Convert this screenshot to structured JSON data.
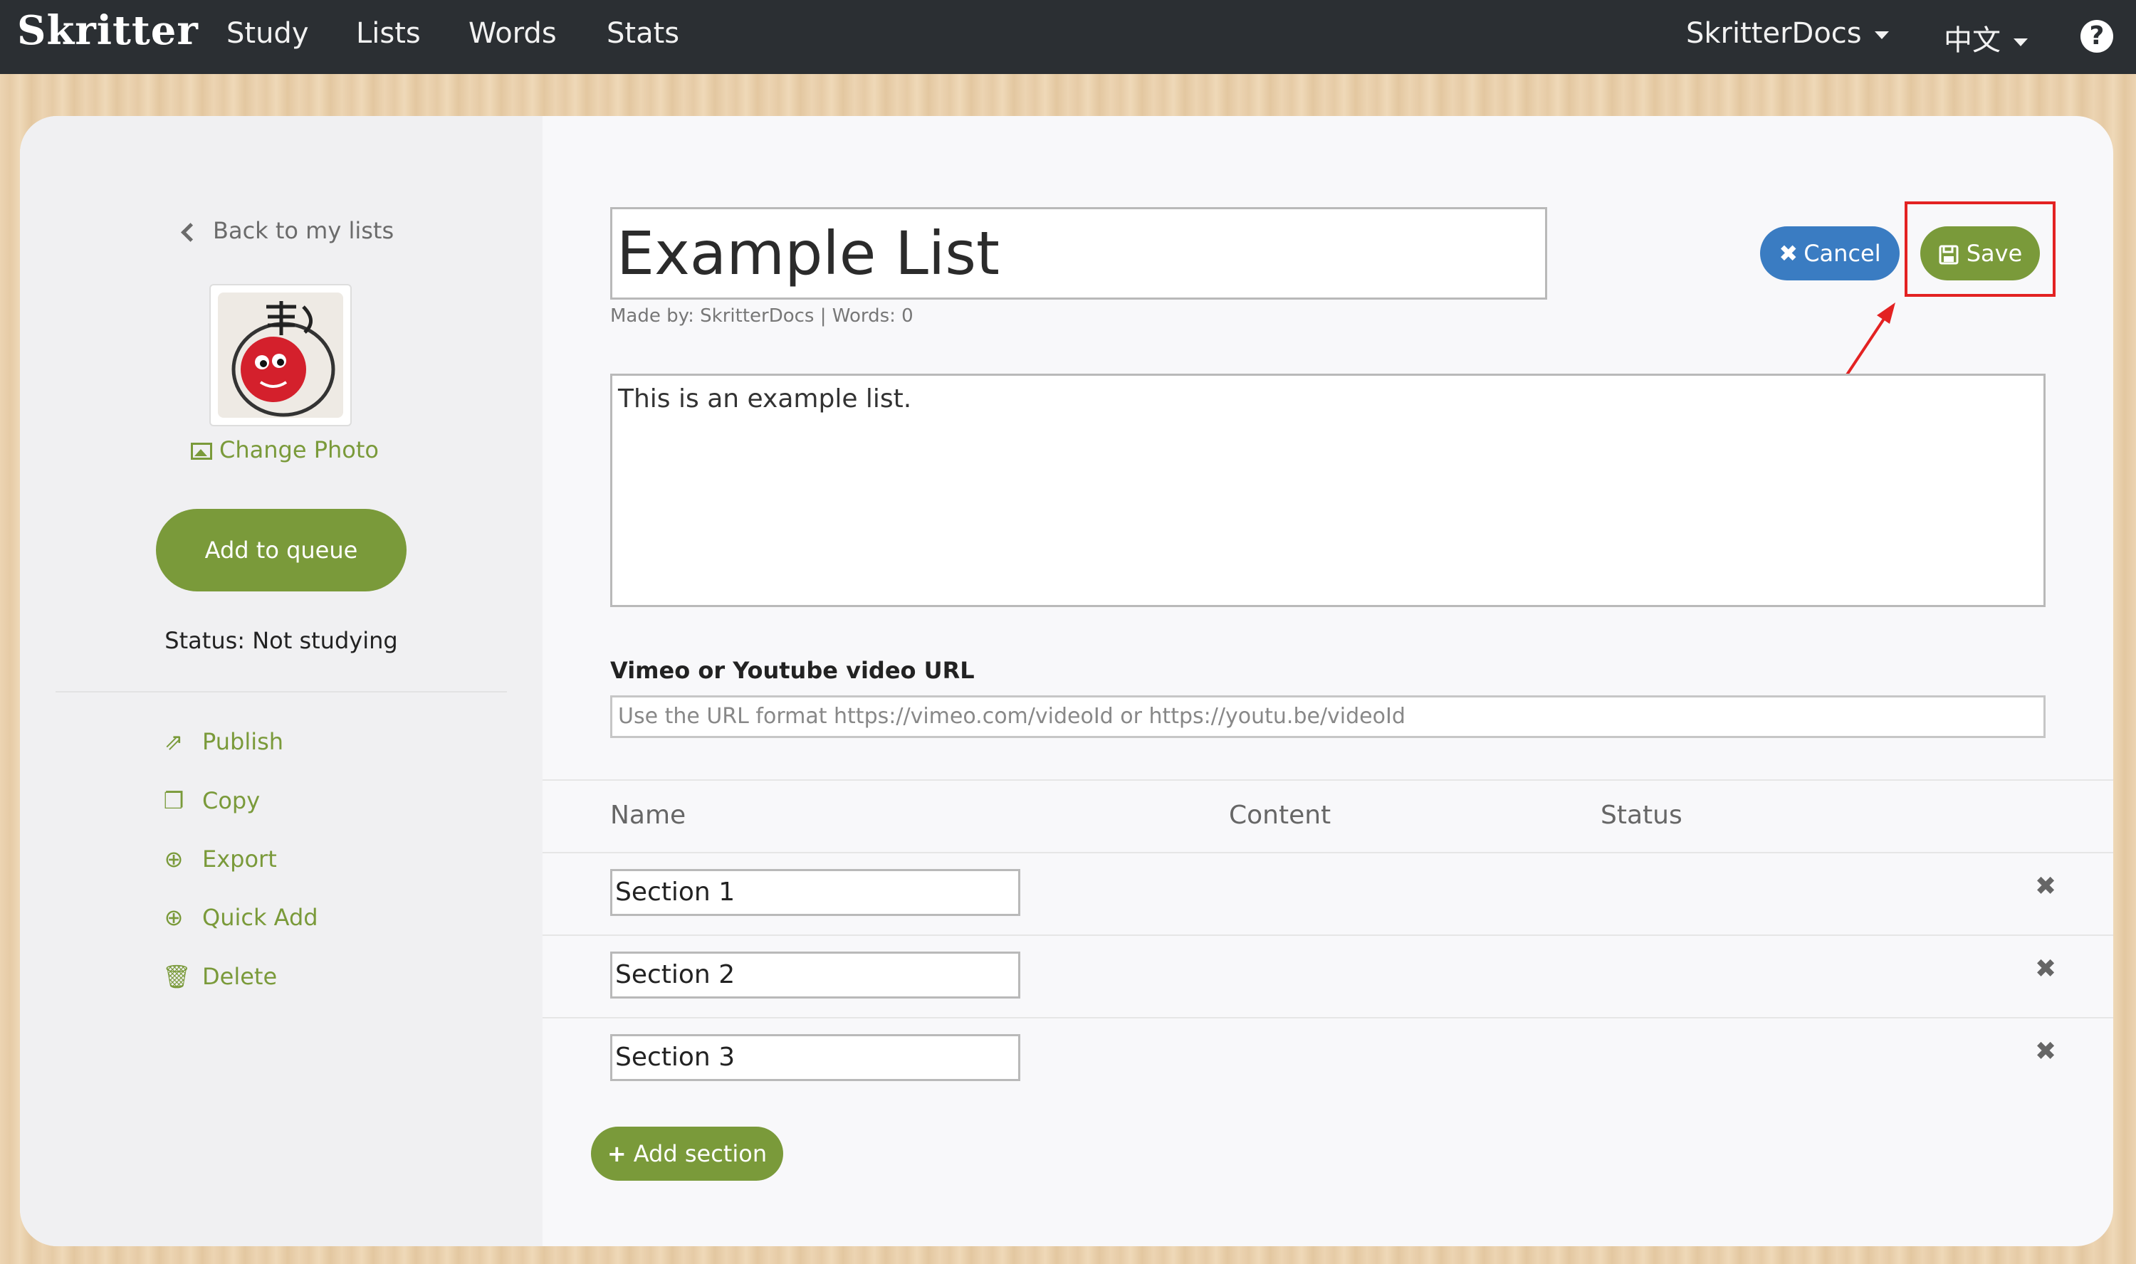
{
  "navbar": {
    "brand": "Skritter",
    "items": [
      "Study",
      "Lists",
      "Words",
      "Stats"
    ],
    "user_menu": "SkritterDocs",
    "language_menu": "中文",
    "help_label": "?"
  },
  "sidebar": {
    "back_label": "Back to my lists",
    "change_photo_label": "Change Photo",
    "queue_button": "Add to queue",
    "status_text": "Status: Not studying",
    "actions": [
      {
        "label": "Publish",
        "icon": "share-icon"
      },
      {
        "label": "Copy",
        "icon": "copy-icon"
      },
      {
        "label": "Export",
        "icon": "download-icon"
      },
      {
        "label": "Quick Add",
        "icon": "plus-circle-icon"
      },
      {
        "label": "Delete",
        "icon": "trash-icon"
      }
    ]
  },
  "editor": {
    "title_value": "Example List",
    "made_by": "Made by: SkritterDocs | Words: 0",
    "cancel_label": "Cancel",
    "save_label": "Save",
    "description_value": "This is an example list.",
    "video_label": "Vimeo or Youtube video URL",
    "video_placeholder": "Use the URL format https://vimeo.com/videoId or https://youtu.be/videoId"
  },
  "table": {
    "headers": [
      "Name",
      "Content",
      "Status"
    ],
    "rows": [
      {
        "name": "Section 1"
      },
      {
        "name": "Section 2"
      },
      {
        "name": "Section 3"
      }
    ],
    "remove_glyph": "✖",
    "add_section_label": "Add section"
  },
  "colors": {
    "navbar": "#2b2f33",
    "accent_green": "#7a9a3a",
    "accent_blue": "#3a7cc2",
    "annotation_red": "#e32222"
  }
}
